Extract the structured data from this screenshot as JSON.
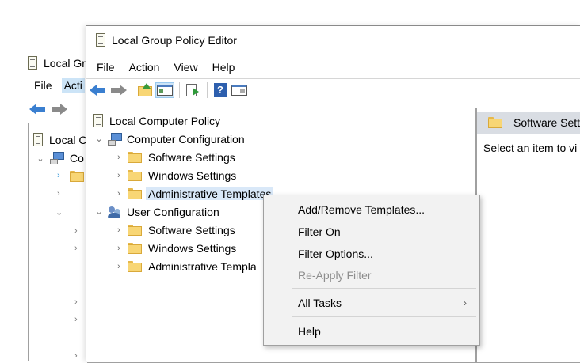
{
  "back_window": {
    "title": "Local Gr",
    "menu": [
      "File",
      "Acti"
    ],
    "tree_label": "Local C",
    "tree_sub": "Co"
  },
  "main_window": {
    "title": "Local Group Policy Editor",
    "menu": [
      "File",
      "Action",
      "View",
      "Help"
    ]
  },
  "tree": {
    "root": "Local Computer Policy",
    "computer_config": {
      "label": "Computer Configuration",
      "children": [
        "Software Settings",
        "Windows Settings",
        "Administrative Templates"
      ]
    },
    "user_config": {
      "label": "User Configuration",
      "children": [
        "Software Settings",
        "Windows Settings",
        "Administrative Templa"
      ]
    }
  },
  "right_pane": {
    "header": "Software Sett",
    "message": "Select an item to vi"
  },
  "context_menu": {
    "items": [
      "Add/Remove Templates...",
      "Filter On",
      "Filter Options...",
      "Re-Apply Filter",
      "All Tasks",
      "Help"
    ],
    "submenu_arrow": "›"
  },
  "glyphs": {
    "chevron_down": "⌄",
    "chevron_right": "›"
  },
  "colors": {
    "folder": "#f8d675",
    "selection": "#d9e8f8",
    "menu_bg": "#f2f2f2",
    "disabled_text": "#8d8d8d"
  }
}
